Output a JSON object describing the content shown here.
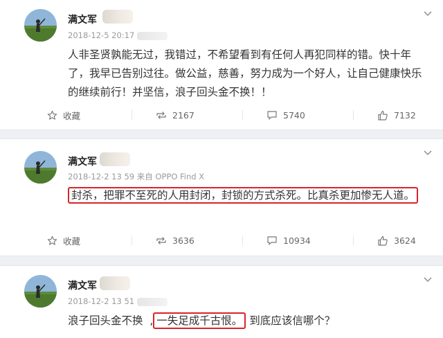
{
  "posts": [
    {
      "username": "满文军",
      "time": "2018-12-5 20:17",
      "source": "",
      "content": "人非圣贤孰能无过，我错过，不希望看到有任何人再犯同样的错。快十年了，我早已告别过往。做公益，慈善，努力成为一个好人，让自己健康快乐的继续前行！并坚信，浪子回头金不换！！",
      "actions": {
        "favorite": "收藏",
        "repost": "2167",
        "comment": "5740",
        "like": "7132"
      }
    },
    {
      "username": "满文军",
      "time": "2018-12-2 13 59",
      "source": "来自 OPPO Find X",
      "content": "封杀，把罪不至死的人用封闭，封锁的方式杀死。比真杀更加惨无人道。",
      "actions": {
        "favorite": "收藏",
        "repost": "3636",
        "comment": "10934",
        "like": "3624"
      }
    },
    {
      "username": "满文军",
      "time": "2018-12-2 13 51",
      "content_part1": "浪子回头金不换",
      "content_part2": "一失足成千古恨。",
      "content_part3": "到底应该信哪个？"
    }
  ],
  "colors": {
    "highlight_border": "#d8232a",
    "text": "#333333",
    "meta": "#9a9a9a"
  },
  "icons": [
    "avatar",
    "chevron-down-icon",
    "star-icon",
    "repost-icon",
    "comment-icon",
    "thumbs-up-icon"
  ]
}
